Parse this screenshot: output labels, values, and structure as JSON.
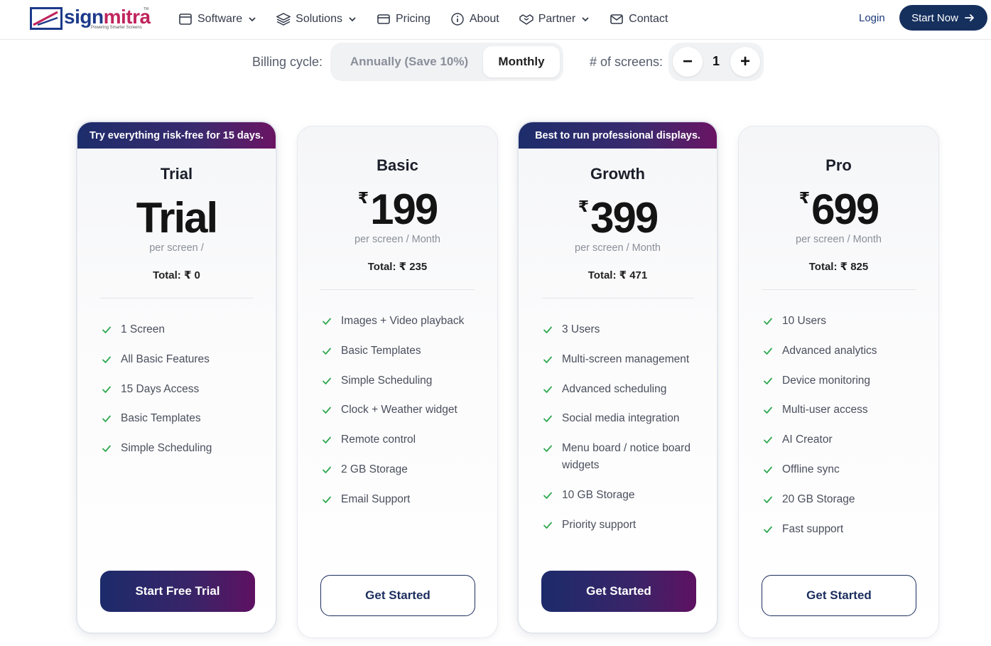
{
  "brand": {
    "word_a": "sign",
    "word_b": "mitra",
    "tagline": "Powering Smarter Screens",
    "tm": "TM"
  },
  "nav": {
    "items": [
      {
        "label": "Software",
        "icon": "window-icon",
        "dropdown": true
      },
      {
        "label": "Solutions",
        "icon": "layers-icon",
        "dropdown": true
      },
      {
        "label": "Pricing",
        "icon": "card-icon",
        "dropdown": false
      },
      {
        "label": "About",
        "icon": "info-icon",
        "dropdown": false
      },
      {
        "label": "Partner",
        "icon": "handshake-icon",
        "dropdown": true
      },
      {
        "label": "Contact",
        "icon": "mail-icon",
        "dropdown": false
      }
    ],
    "login": "Login",
    "start_now": "Start Now"
  },
  "billing": {
    "label": "Billing cycle:",
    "annual": "Annually (Save 10%)",
    "monthly": "Monthly",
    "selected": "Monthly",
    "screens_label": "# of screens:",
    "minus": "−",
    "plus": "+",
    "screens": "1"
  },
  "plans": [
    {
      "ribbon": "Try everything risk-free for 15 days.",
      "name": "Trial",
      "price_text": "Trial",
      "per": "per screen /",
      "total": "Total: ₹ 0",
      "features": [
        "1 Screen",
        "All Basic Features",
        "15 Days Access",
        "Basic Templates",
        "Simple Scheduling"
      ],
      "cta": "Start Free Trial"
    },
    {
      "name": "Basic",
      "currency": "₹",
      "price": "199",
      "per": "per screen / Month",
      "total": "Total: ₹ 235",
      "features": [
        "Images + Video playback",
        "Basic Templates",
        "Simple Scheduling",
        "Clock + Weather widget",
        "Remote control",
        "2 GB Storage",
        "Email Support"
      ],
      "cta": "Get Started"
    },
    {
      "ribbon": "Best to run professional displays.",
      "name": "Growth",
      "currency": "₹",
      "price": "399",
      "per": "per screen / Month",
      "total": "Total: ₹ 471",
      "features": [
        "3 Users",
        "Multi-screen management",
        "Advanced scheduling",
        "Social media integration",
        "Menu board / notice board widgets",
        "10 GB Storage",
        "Priority support"
      ],
      "cta": "Get Started"
    },
    {
      "name": "Pro",
      "currency": "₹",
      "price": "699",
      "per": "per screen / Month",
      "total": "Total: ₹ 825",
      "features": [
        "10 Users",
        "Advanced analytics",
        "Device monitoring",
        "Multi-user access",
        "AI Creator",
        "Offline sync",
        "20 GB Storage",
        "Fast support"
      ],
      "cta": "Get Started"
    }
  ],
  "colors": {
    "brand_navy": "#16305e",
    "ribbon_start": "#1d2d6b",
    "ribbon_end": "#6a1463",
    "check_green": "#2fa84f"
  }
}
